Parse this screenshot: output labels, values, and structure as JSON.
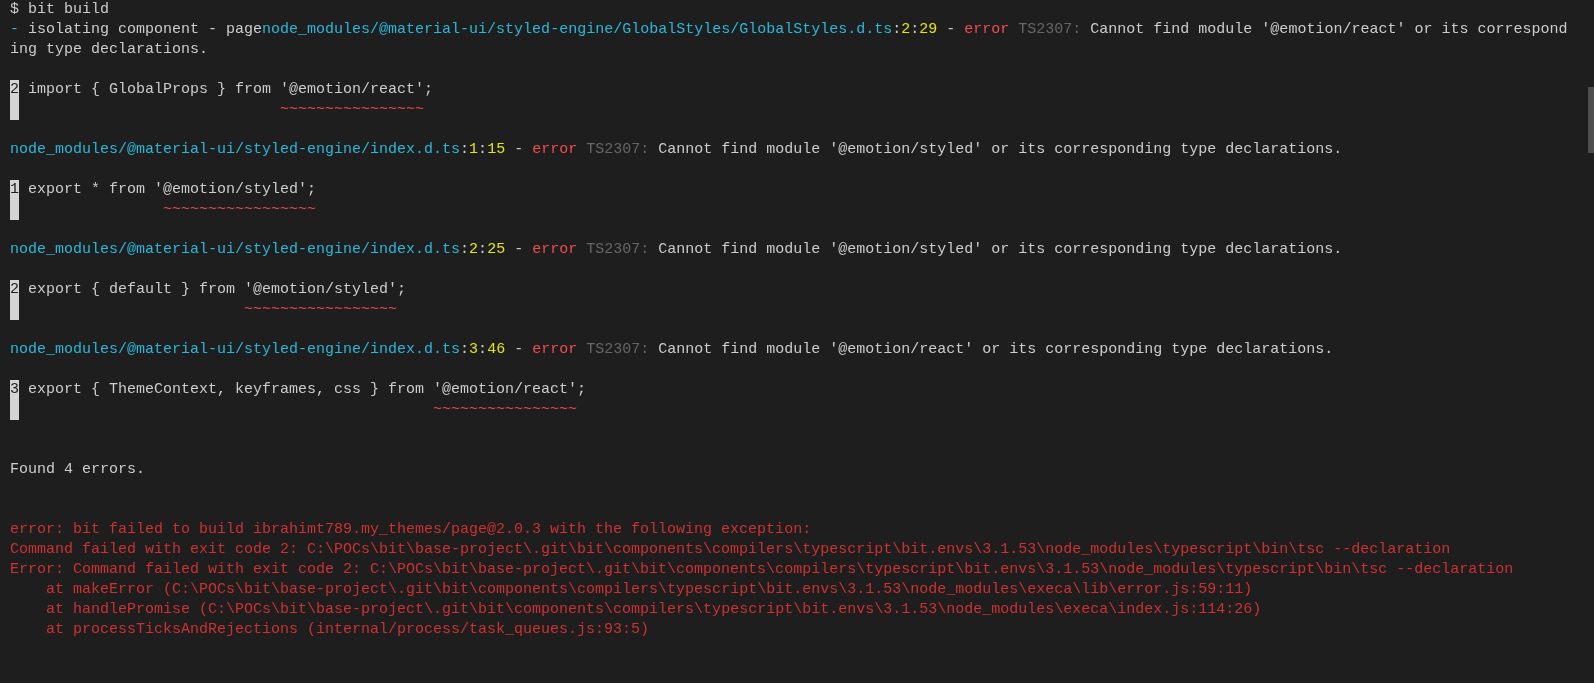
{
  "terminal": {
    "lines": [
      {
        "kind": "text",
        "segments": [
          {
            "text": "$ bit build",
            "kind": "plain"
          }
        ]
      },
      {
        "kind": "text",
        "segments": [
          {
            "text": "-",
            "kind": "prefix"
          },
          {
            "text": " isolating component - page",
            "kind": "plain"
          },
          {
            "text": "node_modules/@material-ui/styled-engine/GlobalStyles/GlobalStyles.d.ts",
            "kind": "path"
          },
          {
            "text": ":",
            "kind": "plain"
          },
          {
            "text": "2",
            "kind": "position"
          },
          {
            "text": ":",
            "kind": "plain"
          },
          {
            "text": "29",
            "kind": "position"
          },
          {
            "text": " - ",
            "kind": "plain"
          },
          {
            "text": "error",
            "kind": "error"
          },
          {
            "text": " TS2307:",
            "kind": "code"
          },
          {
            "text": " Cannot find module '@emotion/react' or its correspond",
            "kind": "plain"
          }
        ]
      },
      {
        "kind": "text",
        "segments": [
          {
            "text": "ing type declarations.",
            "kind": "plain"
          }
        ]
      },
      {
        "kind": "blank"
      },
      {
        "kind": "source",
        "number": "2",
        "code": "import { GlobalProps } from '@emotion/react';"
      },
      {
        "kind": "squiggle",
        "text": "                            ~~~~~~~~~~~~~~~~"
      },
      {
        "kind": "blank"
      },
      {
        "kind": "text",
        "segments": [
          {
            "text": "node_modules/@material-ui/styled-engine/index.d.ts",
            "kind": "path"
          },
          {
            "text": ":",
            "kind": "plain"
          },
          {
            "text": "1",
            "kind": "position"
          },
          {
            "text": ":",
            "kind": "plain"
          },
          {
            "text": "15",
            "kind": "position"
          },
          {
            "text": " - ",
            "kind": "plain"
          },
          {
            "text": "error",
            "kind": "error"
          },
          {
            "text": " TS2307:",
            "kind": "code"
          },
          {
            "text": " Cannot find module '@emotion/styled' or its corresponding type declarations.",
            "kind": "plain"
          }
        ]
      },
      {
        "kind": "blank"
      },
      {
        "kind": "source",
        "number": "1",
        "code": "export * from '@emotion/styled';"
      },
      {
        "kind": "squiggle",
        "text": "               ~~~~~~~~~~~~~~~~~"
      },
      {
        "kind": "blank"
      },
      {
        "kind": "text",
        "segments": [
          {
            "text": "node_modules/@material-ui/styled-engine/index.d.ts",
            "kind": "path"
          },
          {
            "text": ":",
            "kind": "plain"
          },
          {
            "text": "2",
            "kind": "position"
          },
          {
            "text": ":",
            "kind": "plain"
          },
          {
            "text": "25",
            "kind": "position"
          },
          {
            "text": " - ",
            "kind": "plain"
          },
          {
            "text": "error",
            "kind": "error"
          },
          {
            "text": " TS2307:",
            "kind": "code"
          },
          {
            "text": " Cannot find module '@emotion/styled' or its corresponding type declarations.",
            "kind": "plain"
          }
        ]
      },
      {
        "kind": "blank"
      },
      {
        "kind": "source",
        "number": "2",
        "code": "export { default } from '@emotion/styled';"
      },
      {
        "kind": "squiggle",
        "text": "                        ~~~~~~~~~~~~~~~~~"
      },
      {
        "kind": "blank"
      },
      {
        "kind": "text",
        "segments": [
          {
            "text": "node_modules/@material-ui/styled-engine/index.d.ts",
            "kind": "path"
          },
          {
            "text": ":",
            "kind": "plain"
          },
          {
            "text": "3",
            "kind": "position"
          },
          {
            "text": ":",
            "kind": "plain"
          },
          {
            "text": "46",
            "kind": "position"
          },
          {
            "text": " - ",
            "kind": "plain"
          },
          {
            "text": "error",
            "kind": "error"
          },
          {
            "text": " TS2307:",
            "kind": "code"
          },
          {
            "text": " Cannot find module '@emotion/react' or its corresponding type declarations.",
            "kind": "plain"
          }
        ]
      },
      {
        "kind": "blank"
      },
      {
        "kind": "source",
        "number": "3",
        "code": "export { ThemeContext, keyframes, css } from '@emotion/react';"
      },
      {
        "kind": "squiggle",
        "text": "                                             ~~~~~~~~~~~~~~~~"
      },
      {
        "kind": "blank"
      },
      {
        "kind": "blank"
      },
      {
        "kind": "text",
        "segments": [
          {
            "text": "Found 4 errors.",
            "kind": "plain"
          }
        ]
      },
      {
        "kind": "blank"
      },
      {
        "kind": "blank"
      },
      {
        "kind": "text",
        "segments": [
          {
            "text": "error: bit failed to build ibrahimt789.my_themes/page@2.0.3 with the following exception:",
            "kind": "failure"
          }
        ]
      },
      {
        "kind": "text",
        "segments": [
          {
            "text": "Command failed with exit code 2: C:\\POCs\\bit\\base-project\\.git\\bit\\components\\compilers\\typescript\\bit.envs\\3.1.53\\node_modules\\typescript\\bin\\tsc --declaration",
            "kind": "failure"
          }
        ]
      },
      {
        "kind": "text",
        "segments": [
          {
            "text": "Error: Command failed with exit code 2: C:\\POCs\\bit\\base-project\\.git\\bit\\components\\compilers\\typescript\\bit.envs\\3.1.53\\node_modules\\typescript\\bin\\tsc --declaration",
            "kind": "failure"
          }
        ]
      },
      {
        "kind": "text",
        "segments": [
          {
            "text": "    at makeError (C:\\POCs\\bit\\base-project\\.git\\bit\\components\\compilers\\typescript\\bit.envs\\3.1.53\\node_modules\\execa\\lib\\error.js:59:11)",
            "kind": "failure"
          }
        ]
      },
      {
        "kind": "text",
        "segments": [
          {
            "text": "    at handlePromise (C:\\POCs\\bit\\base-project\\.git\\bit\\components\\compilers\\typescript\\bit.envs\\3.1.53\\node_modules\\execa\\index.js:114:26)",
            "kind": "failure"
          }
        ]
      },
      {
        "kind": "text",
        "segments": [
          {
            "text": "    at processTicksAndRejections (internal/process/task_queues.js:93:5)",
            "kind": "failure"
          }
        ]
      }
    ]
  }
}
